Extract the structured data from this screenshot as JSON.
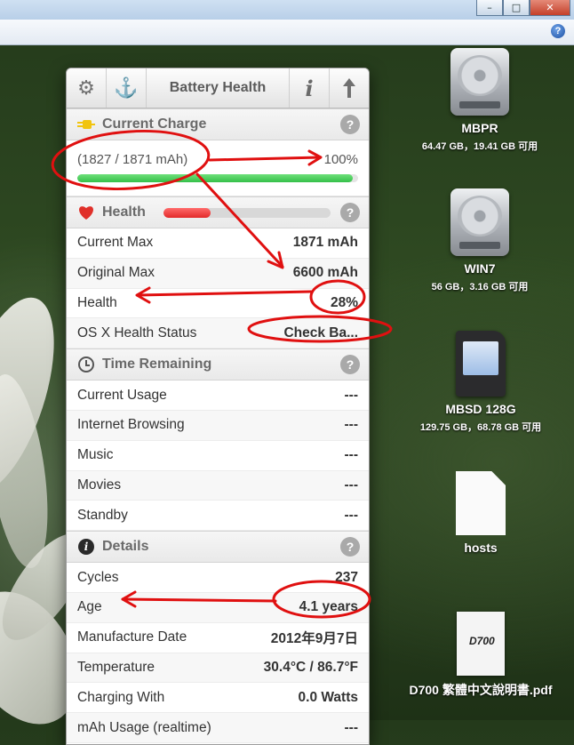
{
  "window": {
    "help_glyph": "?",
    "minimize_glyph": "–",
    "restore_glyph": "□",
    "close_glyph": "✕"
  },
  "panel": {
    "title": "Battery Health",
    "toolbar_icons": [
      "gear-icon",
      "anchor-icon",
      "info-icon",
      "upload-icon"
    ],
    "sections": {
      "current_charge": {
        "title": "Current Charge",
        "mah_text": "(1827 / 1871 mAh)",
        "percent_text": "100%",
        "fill_fraction": 0.98
      },
      "health": {
        "title": "Health",
        "fill_fraction": 0.28,
        "rows": [
          {
            "label": "Current Max",
            "value": "1871 mAh"
          },
          {
            "label": "Original Max",
            "value": "6600 mAh"
          },
          {
            "label": "Health",
            "value": "28%"
          },
          {
            "label": "OS X Health Status",
            "value": "Check Ba..."
          }
        ]
      },
      "time_remaining": {
        "title": "Time Remaining",
        "rows": [
          {
            "label": "Current Usage",
            "value": "---"
          },
          {
            "label": "Internet Browsing",
            "value": "---"
          },
          {
            "label": "Music",
            "value": "---"
          },
          {
            "label": "Movies",
            "value": "---"
          },
          {
            "label": "Standby",
            "value": "---"
          }
        ]
      },
      "details": {
        "title": "Details",
        "rows": [
          {
            "label": "Cycles",
            "value": "237"
          },
          {
            "label": "Age",
            "value": "4.1 years"
          },
          {
            "label": "Manufacture Date",
            "value": "2012年9月7日"
          },
          {
            "label": "Temperature",
            "value": "30.4°C / 86.7°F"
          },
          {
            "label": "Charging With",
            "value": "0.0 Watts"
          },
          {
            "label": "mAh Usage (realtime)",
            "value": "---"
          }
        ]
      }
    },
    "help_glyph": "?"
  },
  "desktop_icons": [
    {
      "name": "MBPR",
      "sub": "64.47 GB，19.41 GB 可用",
      "icon": "hard-drive-icon"
    },
    {
      "name": "WIN7",
      "sub": "56 GB，3.16 GB 可用",
      "icon": "hard-drive-icon"
    },
    {
      "name": "MBSD 128G",
      "sub": "129.75 GB，68.78 GB 可用",
      "icon": "sd-card-icon"
    },
    {
      "name": "hosts",
      "sub": "",
      "icon": "document-icon"
    },
    {
      "name": "D700 繁體中文說明書.pdf",
      "sub": "",
      "icon": "pdf-icon",
      "thumb_text": "D700"
    }
  ],
  "colors": {
    "annotation_red": "#e01010",
    "charge_green": "#35c04a",
    "health_red": "#e22a2a",
    "help_blue": "#1b4fa3"
  }
}
